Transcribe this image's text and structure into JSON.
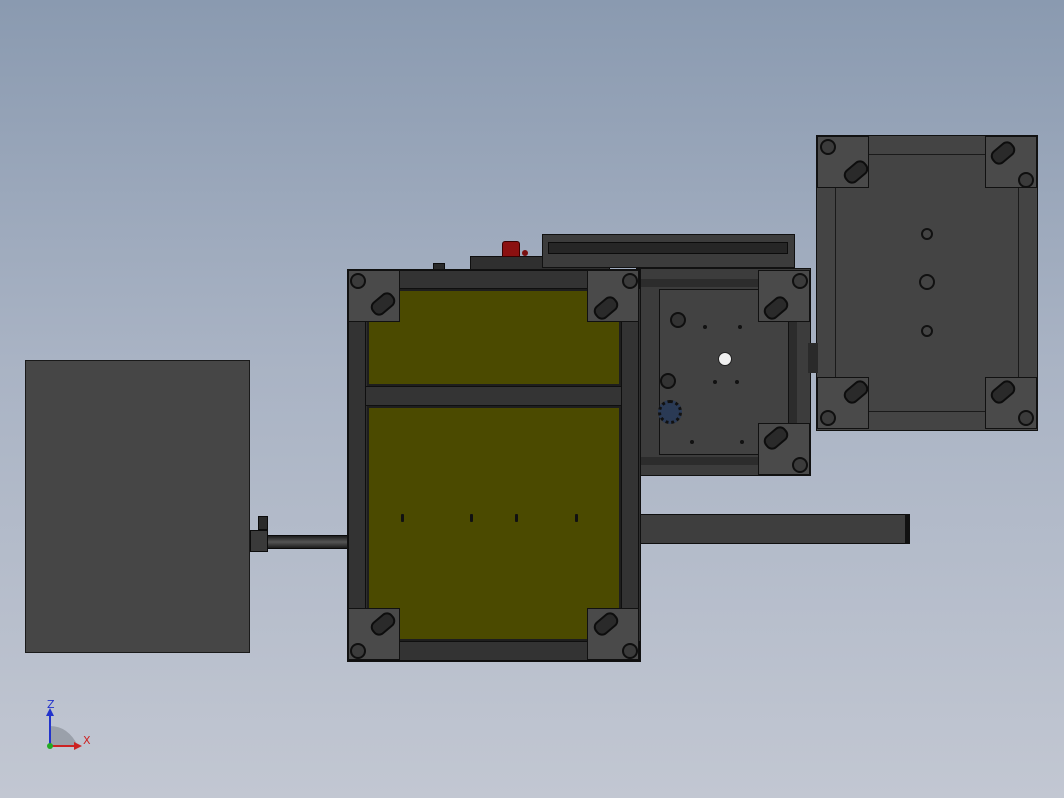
{
  "viewport": {
    "background_top": "#8a9ab0",
    "background_bottom": "#c2c7d2"
  },
  "colors": {
    "frame": "#3a3a3a",
    "panel_fill": "#4b4a00",
    "accent_red": "#8b1010",
    "box": "#454545"
  },
  "triad": {
    "z_label": "Z",
    "x_label": "X",
    "z_color": "#2233cc",
    "x_color": "#cc2222",
    "origin_color": "#22aa22"
  },
  "parts": {
    "box_left": "box",
    "main_frame": "frame",
    "right_table": "table",
    "motor_module": "module",
    "extension_bar": "bar"
  }
}
